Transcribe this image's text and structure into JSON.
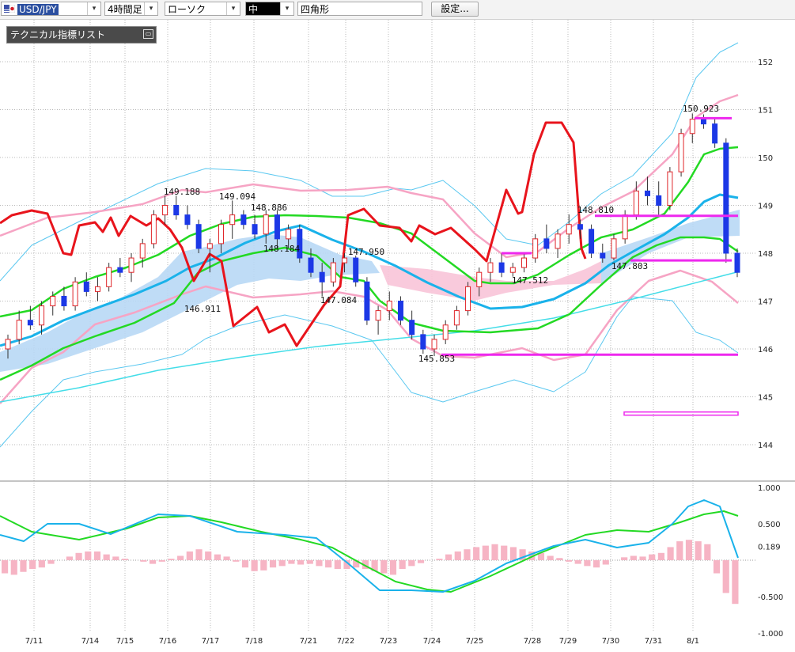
{
  "toolbar": {
    "symbol": "USD/JPY",
    "timeframe": "4時間足",
    "chart_style": "ローソク",
    "line_width": "中",
    "drawing_tool": "四角形",
    "settings_label": "設定..."
  },
  "indicator_panel": {
    "title": "テクニカル指標リスト"
  },
  "colors": {
    "up_candle": "#e0262a",
    "down_candle": "#1c38e6",
    "rsi_line": "#e8141c",
    "ma_green": "#23d923",
    "ma_blue": "#1ab2ea",
    "trend_line": "#44dde8",
    "bollinger": "#5bc8f0",
    "envelope_pink": "#f6a4c4",
    "cloud_blue": "#b8d8f5",
    "cloud_pink": "#f8c4d8",
    "magenta_line": "#ee28ee",
    "osc_bar": "#f6b4c4"
  },
  "chart_data": {
    "type": "candlestick",
    "x_labels": [
      "7/11",
      "7/14",
      "7/15",
      "7/16",
      "7/17",
      "7/18",
      "7/21",
      "7/22",
      "7/23",
      "7/24",
      "7/25",
      "7/28",
      "7/29",
      "7/30",
      "7/31",
      "8/1"
    ],
    "y_ticks": [
      "152",
      "151",
      "150",
      "149",
      "148",
      "147",
      "146",
      "145",
      "144"
    ],
    "y_range": [
      143.3,
      152.3
    ],
    "grid": true,
    "price_annotations": [
      {
        "label": "149.188",
        "value": 149.188
      },
      {
        "label": "149.094",
        "value": 149.094
      },
      {
        "label": "148.886",
        "value": 148.886
      },
      {
        "label": "148.184",
        "value": 148.184
      },
      {
        "label": "146.911",
        "value": 146.911
      },
      {
        "label": "147.950",
        "value": 147.95
      },
      {
        "label": "147.084",
        "value": 147.084
      },
      {
        "label": "145.853",
        "value": 145.853
      },
      {
        "label": "147.512",
        "value": 147.512
      },
      {
        "label": "148.810",
        "value": 148.81
      },
      {
        "label": "147.803",
        "value": 147.803
      },
      {
        "label": "150.923",
        "value": 150.923
      }
    ],
    "horizontal_levels": [
      150.82,
      148.78,
      147.85,
      145.88,
      144.65
    ],
    "candles": [
      [
        146.0,
        146.3,
        145.8,
        146.2
      ],
      [
        146.2,
        146.8,
        146.1,
        146.6
      ],
      [
        146.6,
        146.9,
        146.4,
        146.5
      ],
      [
        146.5,
        147.0,
        146.3,
        146.9
      ],
      [
        146.9,
        147.2,
        146.7,
        147.1
      ],
      [
        147.1,
        147.3,
        146.8,
        146.9
      ],
      [
        146.9,
        147.5,
        146.8,
        147.4
      ],
      [
        147.4,
        147.6,
        147.1,
        147.2
      ],
      [
        147.2,
        147.5,
        147.0,
        147.3
      ],
      [
        147.3,
        147.8,
        147.2,
        147.7
      ],
      [
        147.7,
        147.9,
        147.5,
        147.6
      ],
      [
        147.6,
        148.0,
        147.4,
        147.9
      ],
      [
        147.9,
        148.3,
        147.7,
        148.2
      ],
      [
        148.2,
        148.9,
        148.1,
        148.8
      ],
      [
        148.8,
        149.2,
        148.6,
        149.0
      ],
      [
        149.0,
        149.2,
        148.7,
        148.8
      ],
      [
        148.8,
        149.0,
        148.5,
        148.6
      ],
      [
        148.6,
        148.7,
        148.0,
        148.1
      ],
      [
        148.1,
        148.3,
        147.6,
        148.2
      ],
      [
        148.2,
        148.7,
        148.0,
        148.6
      ],
      [
        148.6,
        149.1,
        148.3,
        148.8
      ],
      [
        148.8,
        148.9,
        148.5,
        148.6
      ],
      [
        148.6,
        148.8,
        148.3,
        148.4
      ],
      [
        148.4,
        148.9,
        148.2,
        148.8
      ],
      [
        148.8,
        148.9,
        148.1,
        148.3
      ],
      [
        148.3,
        148.6,
        148.1,
        148.5
      ],
      [
        148.5,
        148.6,
        147.8,
        147.9
      ],
      [
        147.9,
        148.1,
        147.5,
        147.6
      ],
      [
        147.6,
        147.8,
        147.1,
        147.4
      ],
      [
        147.4,
        147.9,
        147.3,
        147.8
      ],
      [
        147.8,
        148.0,
        147.6,
        147.9
      ],
      [
        147.9,
        147.95,
        147.3,
        147.4
      ],
      [
        147.4,
        147.5,
        146.5,
        146.6
      ],
      [
        146.6,
        146.9,
        146.3,
        146.8
      ],
      [
        146.8,
        147.2,
        146.6,
        147.0
      ],
      [
        147.0,
        147.1,
        146.5,
        146.6
      ],
      [
        146.6,
        146.8,
        146.2,
        146.3
      ],
      [
        146.3,
        146.4,
        145.9,
        146.0
      ],
      [
        146.0,
        146.3,
        145.85,
        146.2
      ],
      [
        146.2,
        146.6,
        146.1,
        146.5
      ],
      [
        146.5,
        146.9,
        146.4,
        146.8
      ],
      [
        146.8,
        147.4,
        146.7,
        147.3
      ],
      [
        147.3,
        147.7,
        147.1,
        147.6
      ],
      [
        147.6,
        147.9,
        147.4,
        147.8
      ],
      [
        147.8,
        148.0,
        147.5,
        147.6
      ],
      [
        147.6,
        147.8,
        147.51,
        147.7
      ],
      [
        147.7,
        148.0,
        147.6,
        147.9
      ],
      [
        147.9,
        148.4,
        147.8,
        148.3
      ],
      [
        148.3,
        148.6,
        148.0,
        148.1
      ],
      [
        148.1,
        148.5,
        147.9,
        148.4
      ],
      [
        148.4,
        148.81,
        148.2,
        148.6
      ],
      [
        148.6,
        148.7,
        148.3,
        148.5
      ],
      [
        148.5,
        148.6,
        147.9,
        148.0
      ],
      [
        148.0,
        148.2,
        147.8,
        147.9
      ],
      [
        147.9,
        148.4,
        147.85,
        148.3
      ],
      [
        148.3,
        148.9,
        148.2,
        148.8
      ],
      [
        148.8,
        149.5,
        148.7,
        149.3
      ],
      [
        149.3,
        149.6,
        149.0,
        149.2
      ],
      [
        149.2,
        149.5,
        148.8,
        149.0
      ],
      [
        149.0,
        149.8,
        148.9,
        149.7
      ],
      [
        149.7,
        150.6,
        149.6,
        150.5
      ],
      [
        150.5,
        150.92,
        150.3,
        150.8
      ],
      [
        150.8,
        150.9,
        150.6,
        150.7
      ],
      [
        150.7,
        150.8,
        150.2,
        150.3
      ],
      [
        150.3,
        150.4,
        147.8,
        148.0
      ],
      [
        148.0,
        148.1,
        147.5,
        147.6
      ]
    ],
    "oscillator": {
      "y_ticks": [
        "1.000",
        "0.500",
        "0.189",
        "-0.500",
        "-1.000"
      ],
      "y_range": [
        -1.0,
        1.0
      ],
      "current_value": 0.189
    }
  }
}
